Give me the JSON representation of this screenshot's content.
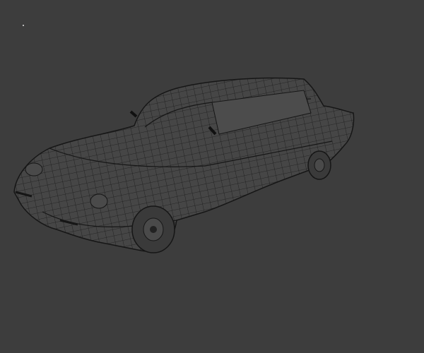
{
  "viewport": {
    "background": "#3d3d3d",
    "body_fill": "#464646",
    "wire_color": "#161616",
    "vertex_marker_color": "#bbbbbb"
  }
}
